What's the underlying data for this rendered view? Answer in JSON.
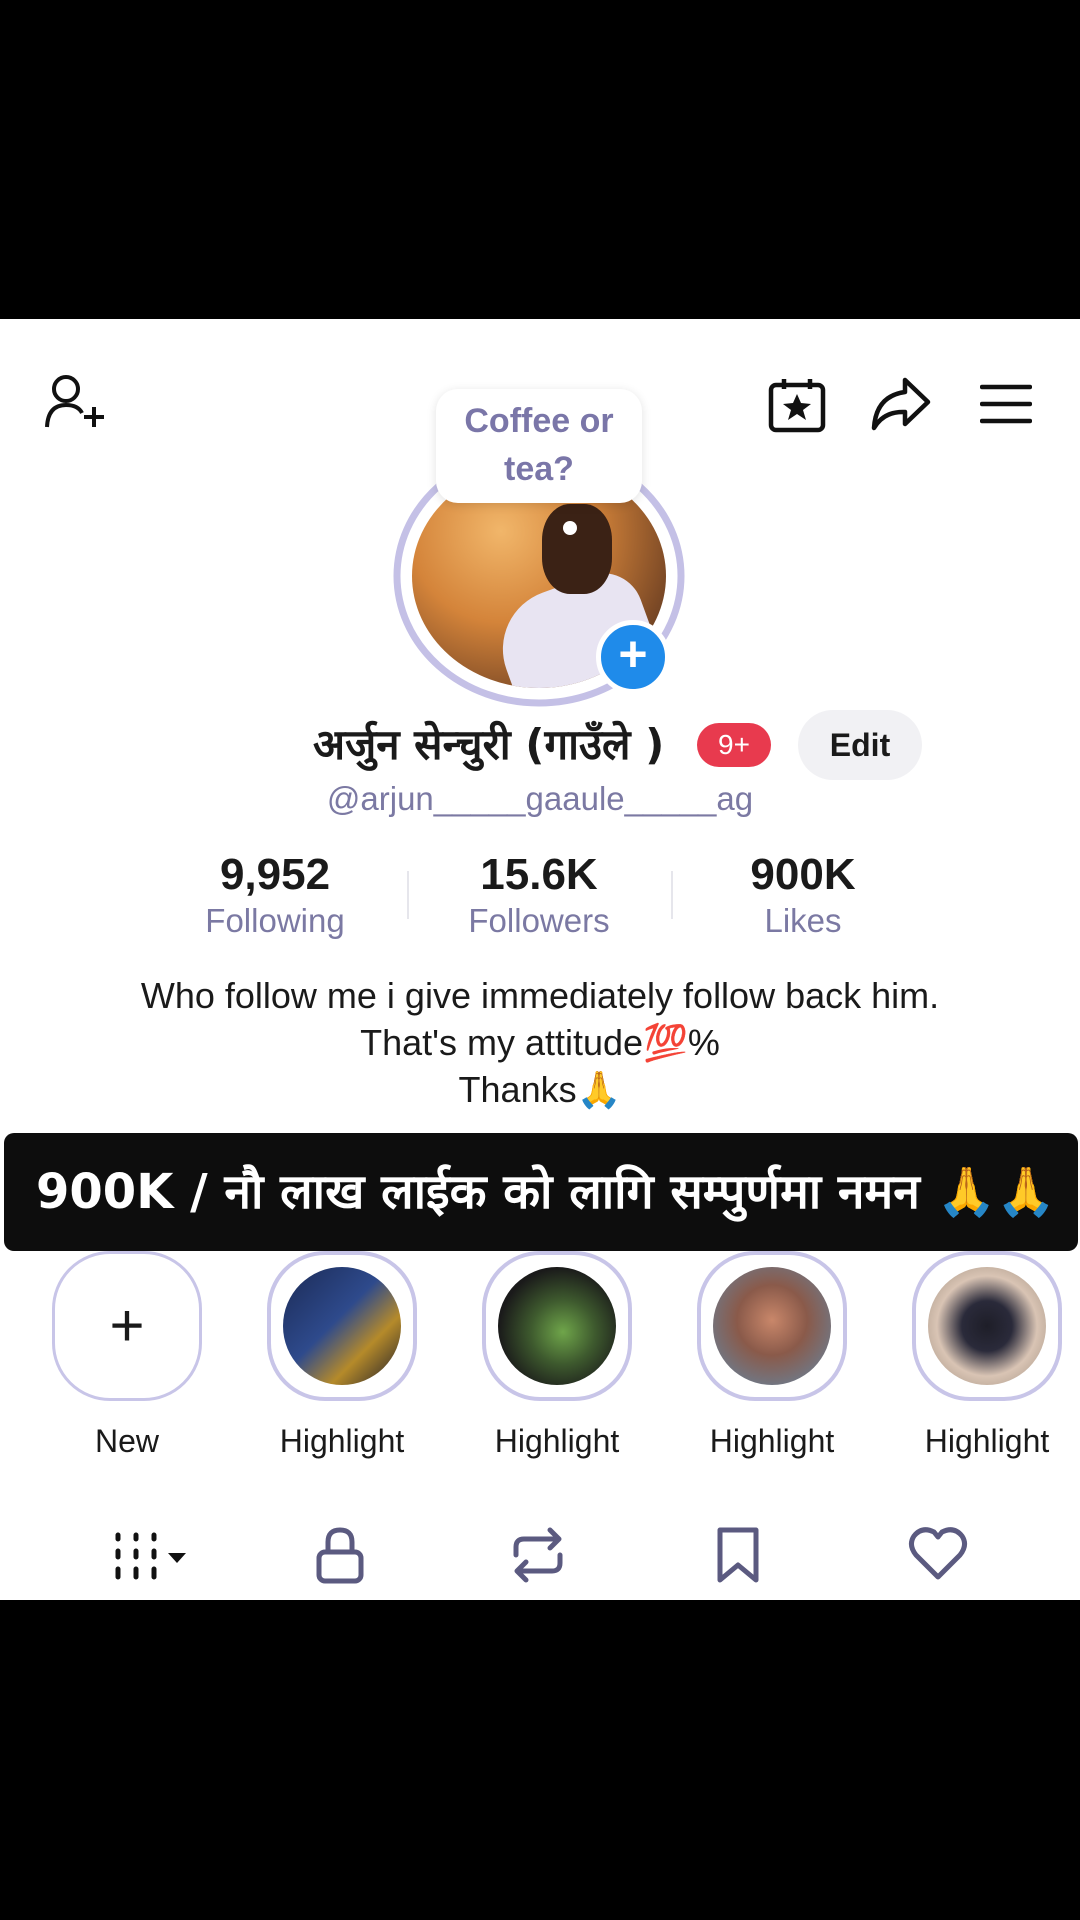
{
  "bubble": {
    "line1": "Coffee or",
    "line2": "tea?"
  },
  "profile": {
    "name": "अर्जुन सेन्चुरी (गाउँले )",
    "notif_badge": "9+",
    "edit_label": "Edit",
    "handle": "@arjun_____gaaule_____ag"
  },
  "stats": [
    {
      "value": "9,952",
      "label": "Following"
    },
    {
      "value": "15.6K",
      "label": "Followers"
    },
    {
      "value": "900K",
      "label": "Likes"
    }
  ],
  "bio": {
    "line1": "Who follow me i give immediately follow back him.",
    "line2": "That's my attitude💯%",
    "line3": "Thanks🙏"
  },
  "banner": {
    "text": "900K / नौ लाख लाईक को लागि सम्पुर्णमा नमन 🙏🙏"
  },
  "highlights": {
    "new_label": "New",
    "new_symbol": "+",
    "items": [
      {
        "label": "Highlight"
      },
      {
        "label": "Highlight"
      },
      {
        "label": "Highlight"
      },
      {
        "label": "Highlight"
      }
    ]
  },
  "plus_symbol": "+",
  "icons": {
    "add_user": "add-user-icon",
    "calendar": "calendar-star-icon",
    "share": "share-icon",
    "menu": "menu-icon",
    "grid": "grid-icon",
    "lock": "lock-icon",
    "repost": "repost-icon",
    "bookmark": "bookmark-icon",
    "heart": "heart-icon"
  },
  "colors": {
    "accent": "#1f8bea",
    "badge": "#e83a4e",
    "muted": "#7b79a3",
    "ring": "#c8c5e8"
  }
}
